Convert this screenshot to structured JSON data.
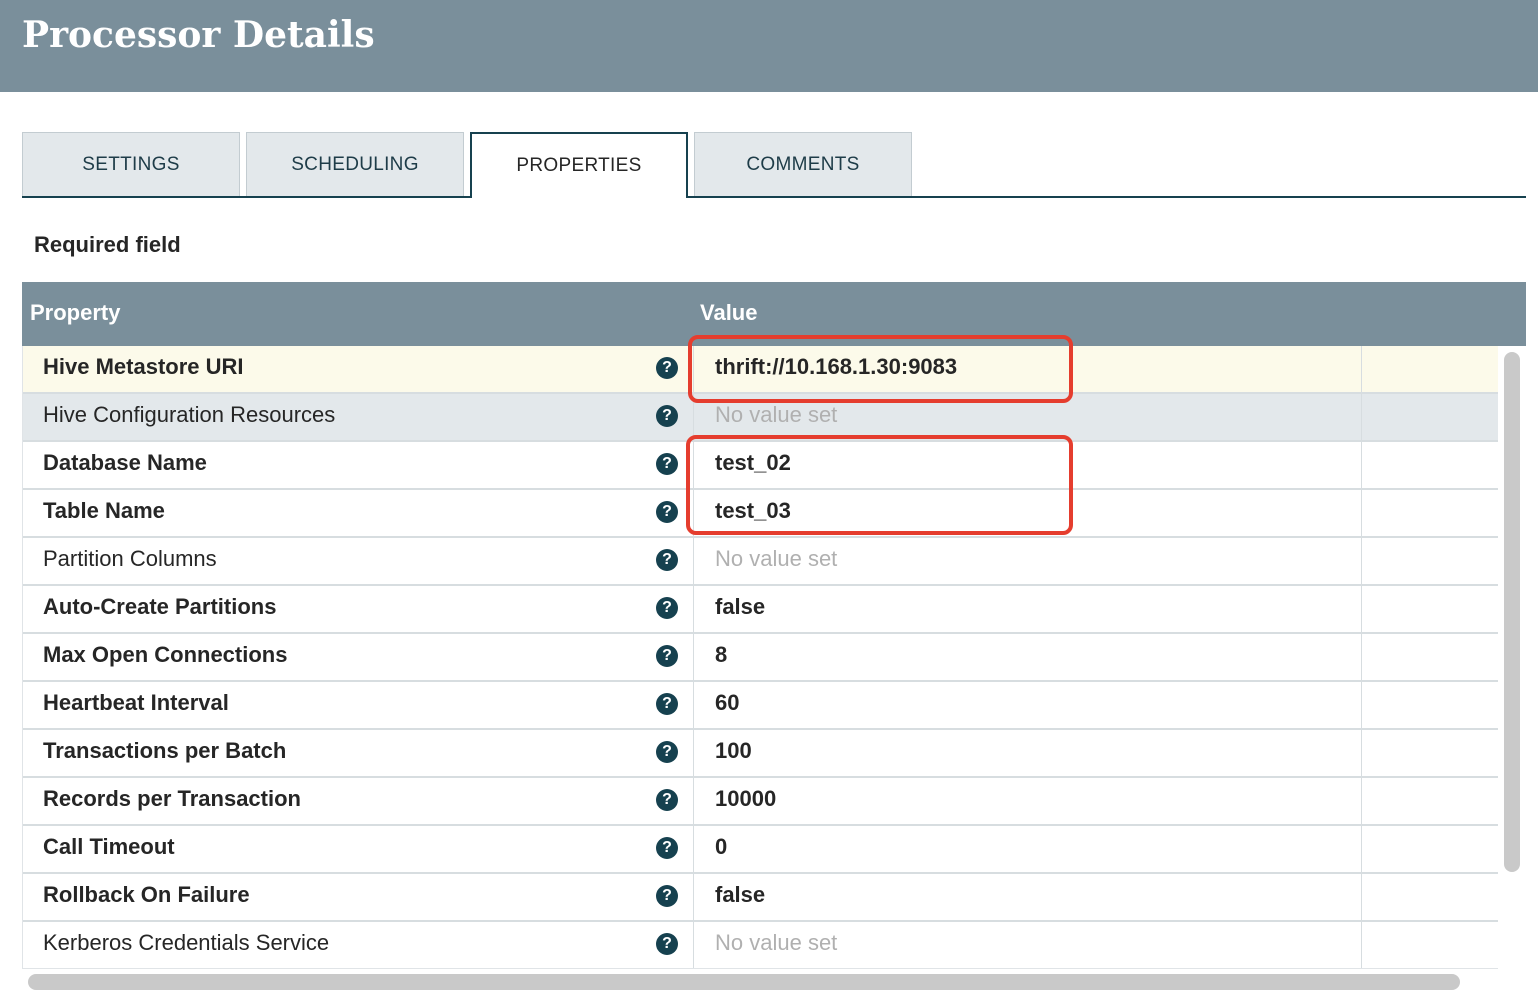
{
  "header": {
    "title": "Processor Details"
  },
  "tabs": [
    {
      "label": "SETTINGS",
      "active": false
    },
    {
      "label": "SCHEDULING",
      "active": false
    },
    {
      "label": "PROPERTIES",
      "active": true
    },
    {
      "label": "COMMENTS",
      "active": false
    }
  ],
  "required_label": "Required field",
  "grid": {
    "columns": {
      "property": "Property",
      "value": "Value"
    },
    "rows": [
      {
        "property": "Hive Metastore URI",
        "value": "thrift://10.168.1.30:9083",
        "required": true
      },
      {
        "property": "Hive Configuration Resources",
        "value": "No value set",
        "required": false
      },
      {
        "property": "Database Name",
        "value": "test_02",
        "required": true
      },
      {
        "property": "Table Name",
        "value": "test_03",
        "required": true
      },
      {
        "property": "Partition Columns",
        "value": "No value set",
        "required": false
      },
      {
        "property": "Auto-Create Partitions",
        "value": "false",
        "required": true
      },
      {
        "property": "Max Open Connections",
        "value": "8",
        "required": true
      },
      {
        "property": "Heartbeat Interval",
        "value": "60",
        "required": true
      },
      {
        "property": "Transactions per Batch",
        "value": "100",
        "required": true
      },
      {
        "property": "Records per Transaction",
        "value": "10000",
        "required": true
      },
      {
        "property": "Call Timeout",
        "value": "0",
        "required": true
      },
      {
        "property": "Rollback On Failure",
        "value": "false",
        "required": true
      },
      {
        "property": "Kerberos Credentials Service",
        "value": "No value set",
        "required": false
      }
    ]
  },
  "icons": {
    "help": "help-circle-icon"
  },
  "colors": {
    "header": "#7a8f9b",
    "accent": "#16414f",
    "annotation": "#e53d2e",
    "highlight_row": "#fcfaea"
  }
}
